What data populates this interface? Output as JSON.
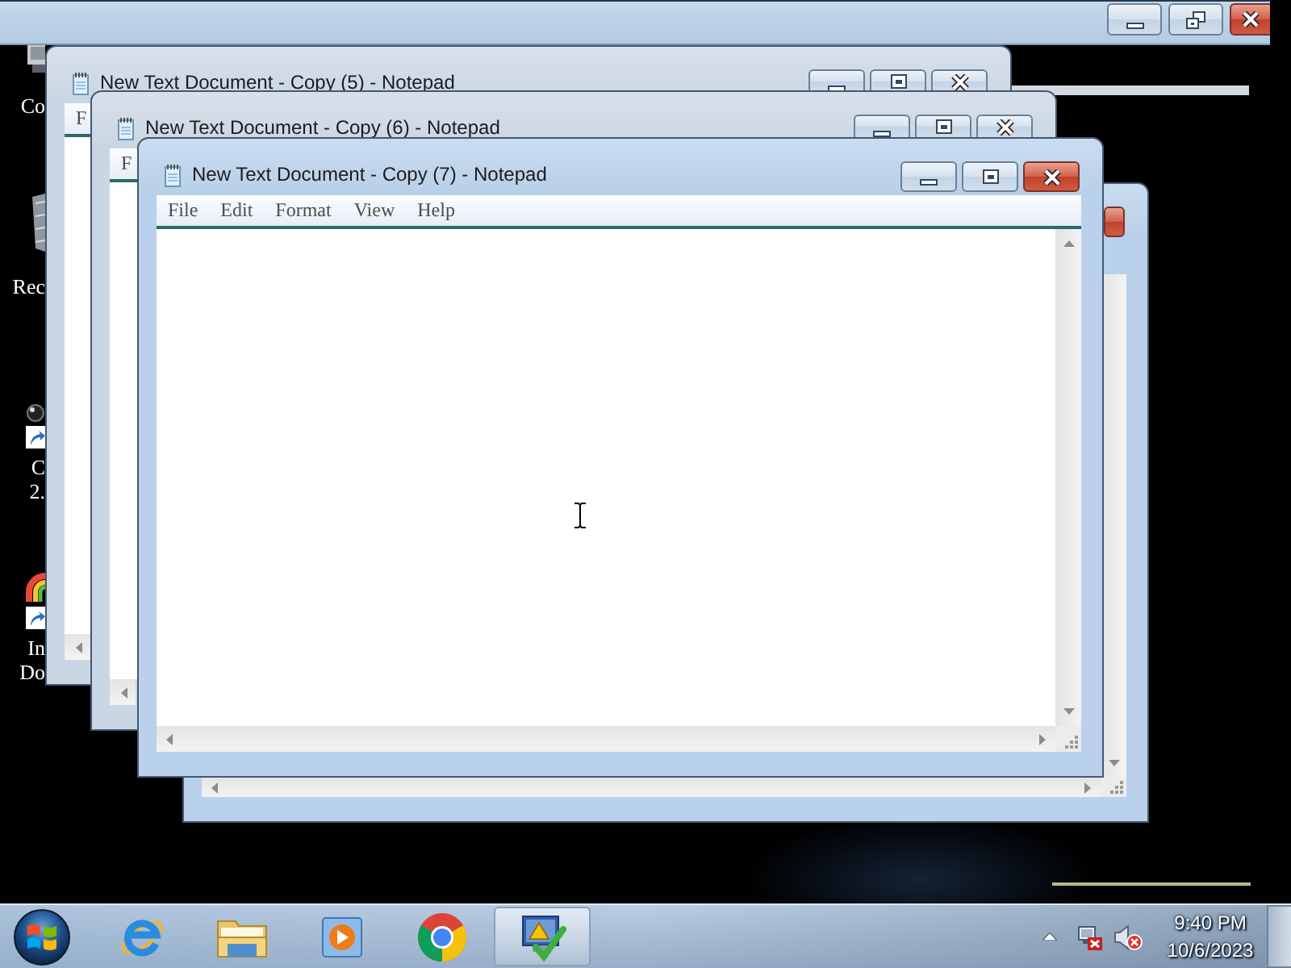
{
  "desktop_icons": [
    {
      "kind": "computer",
      "label": [
        "Co"
      ]
    },
    {
      "kind": "bin",
      "label": [
        "Rec"
      ]
    },
    {
      "kind": "ball",
      "label": [
        "C",
        "2."
      ]
    },
    {
      "kind": "ring",
      "label": [
        "In",
        "Do"
      ]
    }
  ],
  "windows": [
    {
      "title": "New Text Document - Copy (5) - Notepad",
      "active": false,
      "menu": [
        "F"
      ]
    },
    {
      "title": "New Text Document - Copy (6) - Notepad",
      "active": false,
      "menu": [
        "F"
      ]
    },
    {
      "title": "New Text Document - Copy (7) - Notepad",
      "active": true,
      "menu": [
        "File",
        "Edit",
        "Format",
        "View",
        "Help"
      ]
    },
    {
      "active": true
    }
  ],
  "taskbar": {
    "apps": [
      {
        "kind": "browser",
        "selected": false
      },
      {
        "kind": "folder",
        "selected": false
      },
      {
        "kind": "player",
        "selected": false
      },
      {
        "kind": "circle",
        "selected": false
      },
      {
        "kind": "monitor",
        "selected": true
      }
    ],
    "tray": {
      "network_connected": false,
      "muted": true
    },
    "clock": {
      "time": "9:40 PM",
      "date": "10/6/2023"
    }
  }
}
